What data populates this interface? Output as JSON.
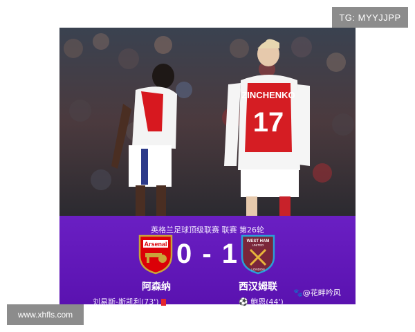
{
  "watermarks": {
    "top_right": "TG: MYYJJPP",
    "bottom_left": "www.xhfls.com"
  },
  "photo": {
    "shirt_name": "ZINCHENKO",
    "shirt_number": "17"
  },
  "match": {
    "competition": "英格兰足球顶级联赛 联赛 第26轮",
    "score": "0 - 1",
    "home": {
      "name": "阿森纳",
      "badge_text": "Arsenal",
      "scorer": "刘易斯-斯凯利(73')",
      "color": "#DB0007"
    },
    "away": {
      "name": "西汉姆联",
      "badge_text": "WEST HAM UNITED",
      "badge_sub": "LONDON",
      "scorer": "鲍恩(44')",
      "color": "#7A263A"
    },
    "credit": "@花畔吟风"
  },
  "colors": {
    "panel": "#5E16B5",
    "watermark_bg": "#8C8C8C"
  },
  "icons": [
    "soccer-ball-icon",
    "red-card-icon",
    "paw-icon"
  ]
}
